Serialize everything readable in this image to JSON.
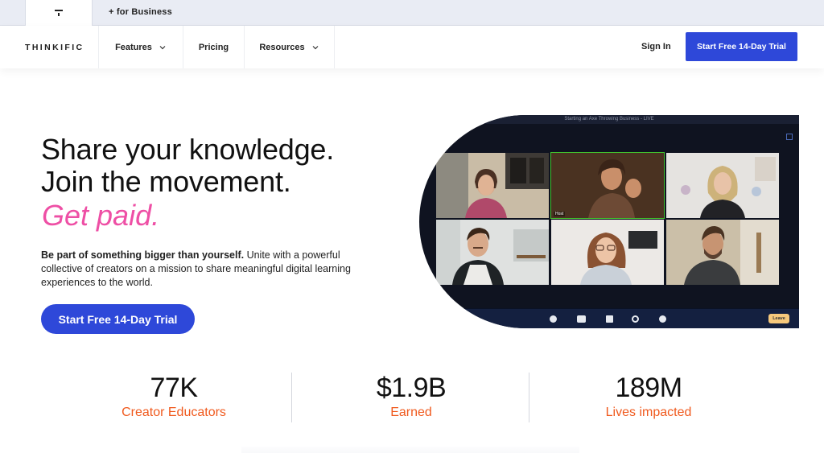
{
  "topbar": {
    "business_link": "+ for Business"
  },
  "nav": {
    "brand": "THINKIFIC",
    "items": [
      {
        "label": "Features",
        "has_dropdown": true
      },
      {
        "label": "Pricing",
        "has_dropdown": false
      },
      {
        "label": "Resources",
        "has_dropdown": true
      }
    ],
    "signin": "Sign In",
    "cta": "Start Free 14-Day Trial"
  },
  "hero": {
    "line1": "Share your knowledge.",
    "line2": "Join the movement.",
    "accent": "Get paid.",
    "lead_bold": "Be part of something bigger than yourself.",
    "lead_rest": " Unite with a powerful collective of creators on a mission to share meaningful digital learning experiences to the world.",
    "cta": "Start Free 14-Day Trial"
  },
  "video_call": {
    "title": "Starting an Axe Throwing Business - LIVE",
    "host_label": "Host",
    "leave_label": "Leave"
  },
  "stats": [
    {
      "value": "77K",
      "label": "Creator Educators"
    },
    {
      "value": "$1.9B",
      "label": "Earned"
    },
    {
      "value": "189M",
      "label": "Lives impacted"
    }
  ],
  "colors": {
    "primary": "#2e48d9",
    "accent_pink": "#ee4fa5",
    "stat_orange": "#f05a1e",
    "topbar_bg": "#e9ecf4"
  }
}
